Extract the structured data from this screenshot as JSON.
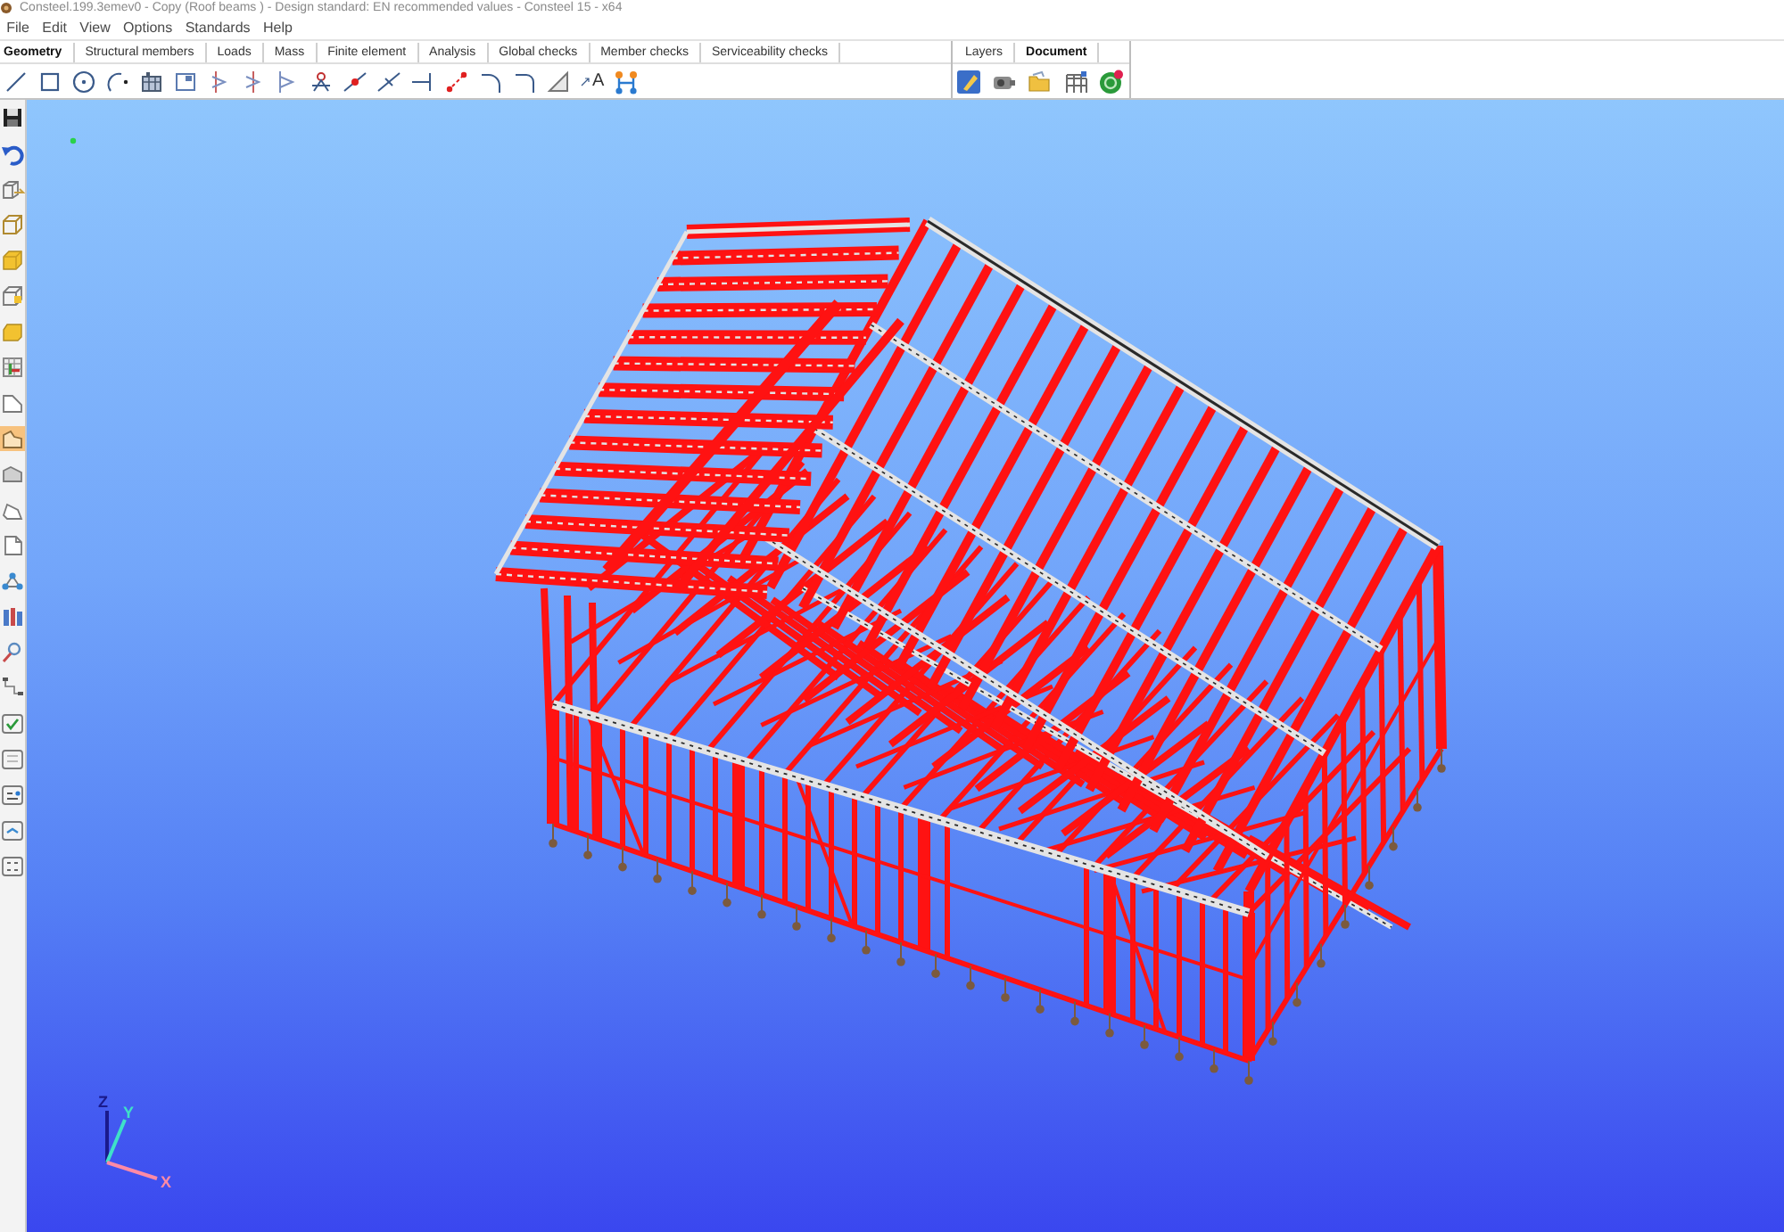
{
  "window": {
    "title": "Consteel.199.3emev0 - Copy (Roof beams ) - Design standard: EN recommended values - Consteel 15 - x64"
  },
  "menu": [
    "File",
    "Edit",
    "View",
    "Options",
    "Standards",
    "Help"
  ],
  "ribbon_tabs": [
    {
      "label": "Geometry",
      "selected": true
    },
    {
      "label": "Structural members",
      "selected": false
    },
    {
      "label": "Loads",
      "selected": false
    },
    {
      "label": "Mass",
      "selected": false
    },
    {
      "label": "Finite element",
      "selected": false
    },
    {
      "label": "Analysis",
      "selected": false
    },
    {
      "label": "Global checks",
      "selected": false
    },
    {
      "label": "Member checks",
      "selected": false
    },
    {
      "label": "Serviceability checks",
      "selected": false
    }
  ],
  "toolbar": {
    "label_tool_glyph": "A"
  },
  "panel_tabs": [
    {
      "label": "Layers",
      "selected": false
    },
    {
      "label": "Document",
      "selected": true
    }
  ],
  "side_toolbar": [
    {
      "selected": false
    },
    {
      "selected": false
    },
    {
      "selected": false
    },
    {
      "selected": false
    },
    {
      "selected": false
    },
    {
      "selected": false
    },
    {
      "selected": false
    },
    {
      "selected": false
    },
    {
      "selected": false
    },
    {
      "selected": true
    },
    {
      "selected": false
    },
    {
      "selected": false
    },
    {
      "selected": false
    },
    {
      "selected": false
    },
    {
      "selected": false
    },
    {
      "selected": false
    },
    {
      "selected": false
    },
    {
      "selected": false
    },
    {
      "selected": false
    },
    {
      "selected": false
    },
    {
      "selected": false
    },
    {
      "selected": false
    }
  ],
  "viewport": {
    "axes": [
      {
        "label": "Z",
        "color": "#1a1a8c"
      },
      {
        "label": "Y",
        "color": "#3fe0c8"
      },
      {
        "label": "X",
        "color": "#ff8aa5"
      }
    ]
  }
}
